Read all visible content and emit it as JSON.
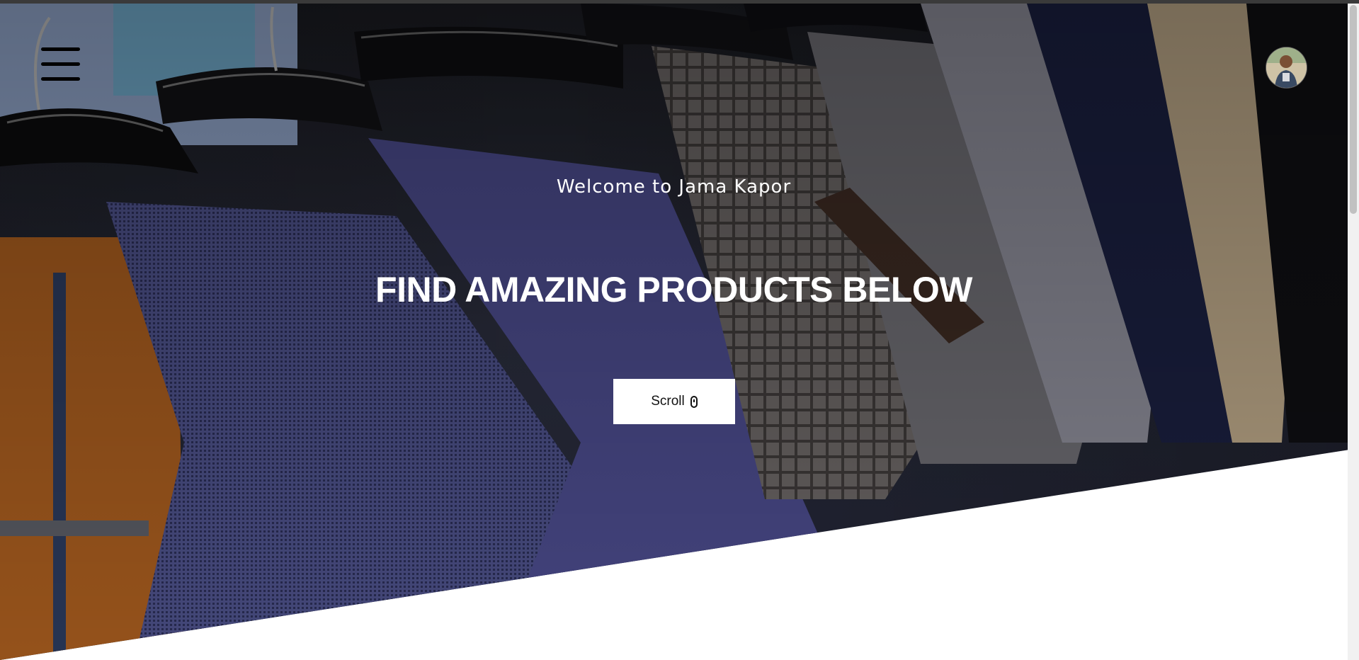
{
  "hero": {
    "welcome_text": "Welcome to Jama Kapor",
    "headline": "FIND AMAZING PRODUCTS BELOW",
    "scroll_label": "Scroll",
    "background_image": "suits-on-hangers-photo"
  },
  "header": {
    "menu_icon": "hamburger-menu-icon",
    "avatar_icon": "user-avatar"
  },
  "colors": {
    "text_light": "#ffffff",
    "button_bg": "#ffffff",
    "menu_bar": "#000000",
    "page_bg": "#ffffff"
  }
}
